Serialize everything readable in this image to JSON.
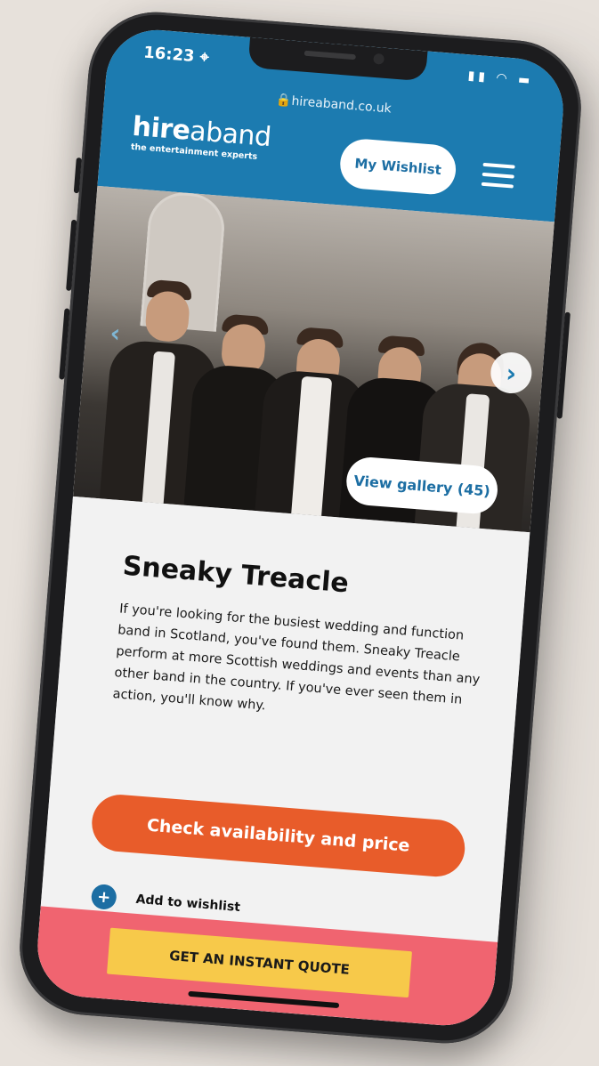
{
  "status": {
    "time": "16:23 ⌖",
    "icons": "▮▮ ◠ ▬"
  },
  "browser": {
    "url": "🔒hireaband.co.uk"
  },
  "header": {
    "logo_bold": "hire",
    "logo_light": "aband",
    "logo_tagline": "the entertainment experts",
    "wishlist_label": "My Wishlist",
    "menu_icon": "hamburger-icon"
  },
  "hero": {
    "prev_arrow": "‹",
    "next_arrow": "›",
    "gallery_label": "View gallery (45)"
  },
  "band": {
    "title": "Sneaky Treacle",
    "description": "If you're looking for the busiest wedding and function band in Scotland, you've found them. Sneaky Treacle perform at more Scottish weddings and events than any other band in the country. If you've ever seen them in action, you'll know why."
  },
  "actions": {
    "check_label": "Check availability and price",
    "wishlist_plus": "+",
    "add_wishlist_label": "Add to wishlist"
  },
  "footer": {
    "quote_label": "GET AN INSTANT QUOTE"
  },
  "colors": {
    "brand_blue": "#1c7bb0",
    "cta_orange": "#e85c2a",
    "footer_pink": "#f06470",
    "quote_yellow": "#f7c94a"
  }
}
